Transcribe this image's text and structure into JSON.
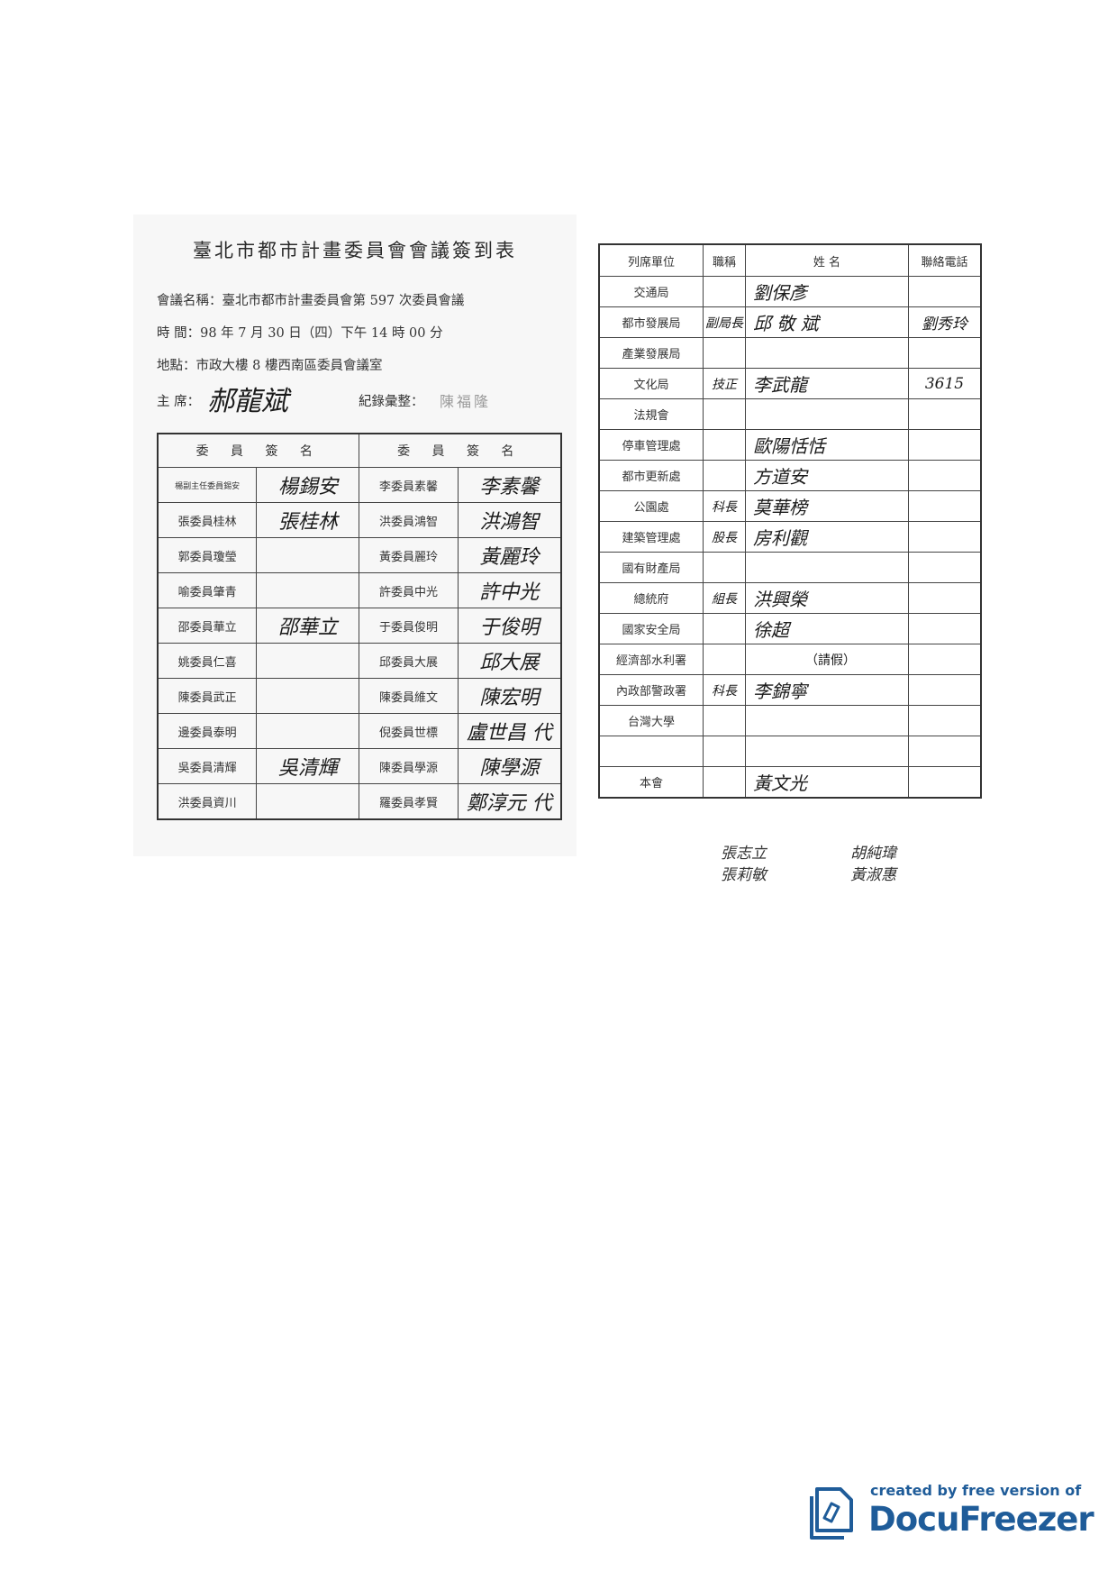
{
  "left_sheet": {
    "title": "臺北市都市計畫委員會會議簽到表",
    "meeting_name": "會議名稱：臺北市都市計畫委員會第 597 次委員會議",
    "time": "時 間：98 年 7 月 30 日（四）下午 14 時 00 分",
    "place": "地點：市政大樓 8 樓西南區委員會議室",
    "chair_label": "主 席：",
    "chair_signature": "郝龍斌",
    "recorder_label": "紀錄彙整：",
    "recorder_name": "陳福隆",
    "header_left": "委 員 簽 名",
    "header_right": "委 員 簽 名",
    "rows": [
      {
        "left_role": "楊副主任委員錫安",
        "left_sign": "楊錫安",
        "right_role": "李委員素馨",
        "right_sign": "李素馨"
      },
      {
        "left_role": "張委員桂林",
        "left_sign": "張桂林",
        "right_role": "洪委員鴻智",
        "right_sign": "洪鴻智"
      },
      {
        "left_role": "郭委員瓊瑩",
        "left_sign": "",
        "right_role": "黃委員麗玲",
        "right_sign": "黃麗玲"
      },
      {
        "left_role": "喻委員肇青",
        "left_sign": "",
        "right_role": "許委員中光",
        "right_sign": "許中光"
      },
      {
        "left_role": "邵委員華立",
        "left_sign": "邵華立",
        "right_role": "于委員俊明",
        "right_sign": "于俊明"
      },
      {
        "left_role": "姚委員仁喜",
        "left_sign": "",
        "right_role": "邱委員大展",
        "right_sign": "邱大展"
      },
      {
        "left_role": "陳委員武正",
        "left_sign": "",
        "right_role": "陳委員維文",
        "right_sign": "陳宏明"
      },
      {
        "left_role": "邊委員泰明",
        "left_sign": "",
        "right_role": "倪委員世標",
        "right_sign": "盧世昌 代"
      },
      {
        "left_role": "吳委員清輝",
        "left_sign": "吳清輝",
        "right_role": "陳委員學源",
        "right_sign": "陳學源"
      },
      {
        "left_role": "洪委員資川",
        "left_sign": "",
        "right_role": "羅委員孝賢",
        "right_sign": "鄭淳元 代"
      }
    ]
  },
  "right_sheet": {
    "headers": [
      "列席單位",
      "職稱",
      "姓 名",
      "聯絡電話"
    ],
    "rows": [
      {
        "unit": "交通局",
        "title": "",
        "name": "劉保彥",
        "phone": ""
      },
      {
        "unit": "都市發展局",
        "title": "副局長",
        "name": "邱 敬 斌",
        "phone": "劉秀玲"
      },
      {
        "unit": "產業發展局",
        "title": "",
        "name": "",
        "phone": ""
      },
      {
        "unit": "文化局",
        "title": "技正",
        "name": "李武龍",
        "phone": "3615"
      },
      {
        "unit": "法規會",
        "title": "",
        "name": "",
        "phone": ""
      },
      {
        "unit": "停車管理處",
        "title": "",
        "name": "歐陽恬恬",
        "phone": ""
      },
      {
        "unit": "都市更新處",
        "title": "",
        "name": "方道安",
        "phone": ""
      },
      {
        "unit": "公園處",
        "title": "科長",
        "name": "莫華榜",
        "phone": ""
      },
      {
        "unit": "建築管理處",
        "title": "股長",
        "name": "房利觀",
        "phone": ""
      },
      {
        "unit": "國有財產局",
        "title": "",
        "name": "",
        "phone": ""
      },
      {
        "unit": "總統府",
        "title": "組長",
        "name": "洪興榮",
        "phone": ""
      },
      {
        "unit": "國家安全局",
        "title": "",
        "name": "徐超",
        "phone": ""
      },
      {
        "unit": "經濟部水利署",
        "title": "",
        "name": "（請假）",
        "phone": ""
      },
      {
        "unit": "內政部警政署",
        "title": "科長",
        "name": "李錦寧",
        "phone": ""
      },
      {
        "unit": "台灣大學",
        "title": "",
        "name": "",
        "phone": ""
      },
      {
        "unit": "",
        "title": "",
        "name": "",
        "phone": ""
      },
      {
        "unit": "本會",
        "title": "",
        "name": "黃文光",
        "phone": ""
      }
    ],
    "extra_signatures": [
      "張志立",
      "張莉敏",
      "胡純瑋",
      "黃淑惠"
    ]
  },
  "branding": {
    "line1": "created by free version of",
    "line2": "DocuFreezer",
    "color": "#1f5c99"
  }
}
